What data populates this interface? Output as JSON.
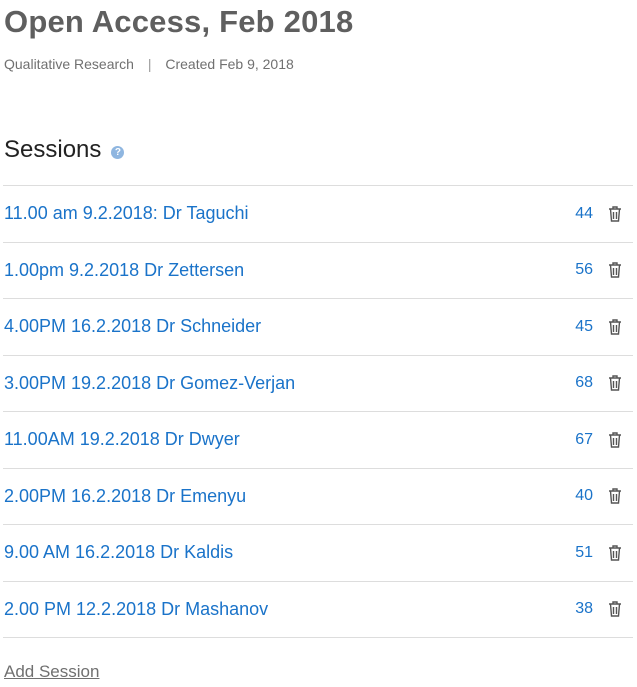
{
  "header": {
    "title": "Open Access, Feb 2018",
    "project_type": "Qualitative Research",
    "separator": "|",
    "created": "Created Feb 9, 2018"
  },
  "sessions": {
    "heading": "Sessions",
    "help_icon": "question-circle-icon",
    "items": [
      {
        "name": "11.00 am 9.2.2018: Dr Taguchi",
        "count": "44"
      },
      {
        "name": "1.00pm 9.2.2018 Dr Zettersen",
        "count": "56"
      },
      {
        "name": "4.00PM 16.2.2018 Dr Schneider",
        "count": "45"
      },
      {
        "name": "3.00PM 19.2.2018 Dr Gomez-Verjan",
        "count": "68"
      },
      {
        "name": "11.00AM 19.2.2018 Dr Dwyer",
        "count": "67"
      },
      {
        "name": "2.00PM 16.2.2018 Dr Emenyu",
        "count": "40"
      },
      {
        "name": "9.00 AM 16.2.2018 Dr Kaldis",
        "count": "51"
      },
      {
        "name": "2.00 PM 12.2.2018 Dr Mashanov",
        "count": "38"
      }
    ],
    "delete_icon": "trash-icon",
    "add_label": "Add Session"
  },
  "colors": {
    "link": "#1a73c9",
    "title": "#5f5f5f",
    "divider": "#dddddd",
    "help_icon": "#8fb6e0"
  }
}
